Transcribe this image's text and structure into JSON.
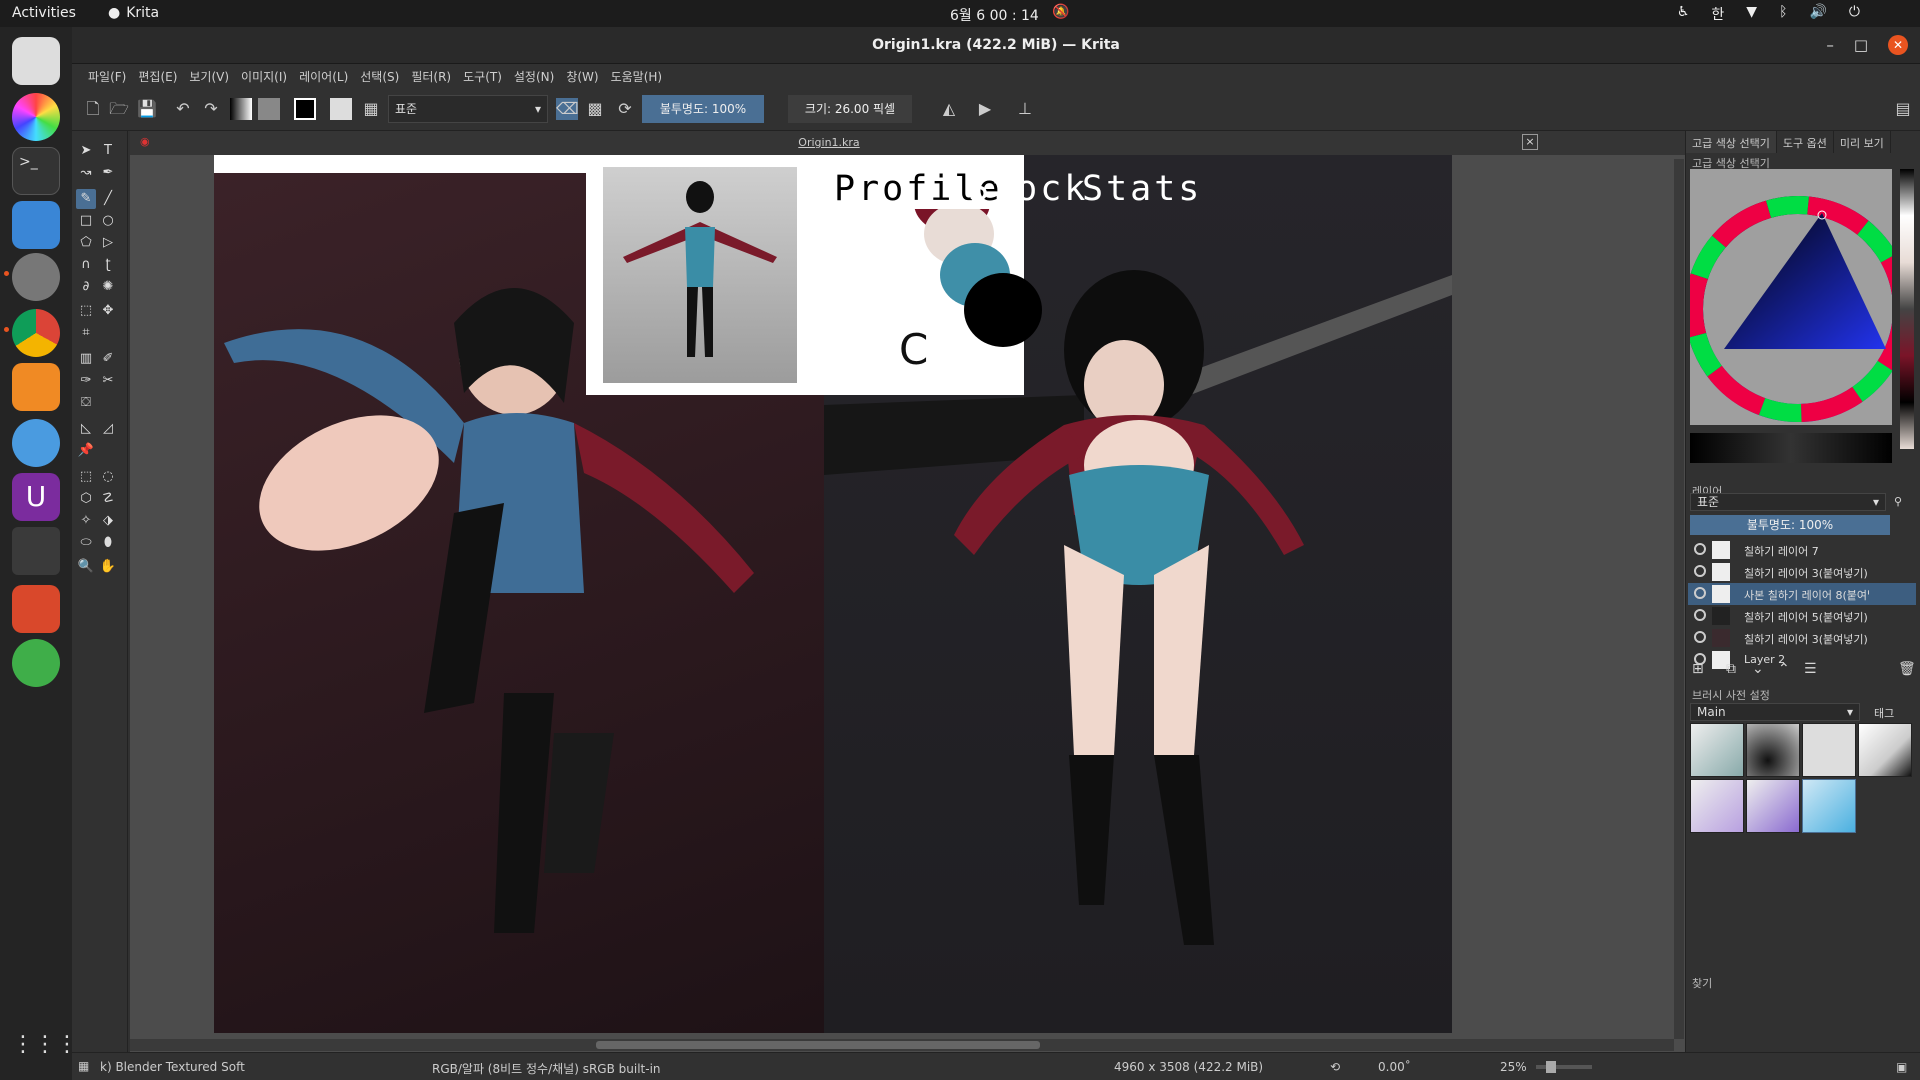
{
  "system": {
    "activities": "Activities",
    "app_name": "Krita",
    "clock": "6월 6  00 : 14",
    "tray_lang": "한"
  },
  "window": {
    "title": "Origin1.kra (422.2 MiB) — Krita",
    "minimize": "–",
    "maximize": "□",
    "close": "✕"
  },
  "menu": [
    "파일(F)",
    "편집(E)",
    "보기(V)",
    "이미지(I)",
    "레이어(L)",
    "선택(S)",
    "필터(R)",
    "도구(T)",
    "설정(N)",
    "창(W)",
    "도움말(H)"
  ],
  "toolbar": {
    "blend_mode": "표준",
    "opacity": "불투명도: 100%",
    "size": "크기: 26.00 픽셀"
  },
  "document": {
    "tab_name": "Origin1.kra",
    "tab_close": "×",
    "canvas_tabs": [
      "Profile",
      "Stock",
      "Stats"
    ],
    "palette_colors": [
      "#7a1428",
      "#e8dcd6",
      "#3f8fa8",
      "#000000"
    ]
  },
  "dockers": {
    "tabs": [
      "고급 색상 선택기",
      "도구 옵션",
      "미리 보기"
    ],
    "color_selector_title": "고급 색상 선택기",
    "layers_title": "레이어",
    "layers_blend": "표준",
    "layers_opacity": "불투명도: 100%",
    "layers": [
      {
        "name": "칠하기 레이어 7",
        "selected": false
      },
      {
        "name": "칠하기 레이어 3(붙여넣기)",
        "selected": false
      },
      {
        "name": "사본 칠하기 레이어 8(붙여넣...",
        "selected": true
      },
      {
        "name": "칠하기 레이어 5(붙여넣기)",
        "selected": false
      },
      {
        "name": "칠하기 레이어 3(붙여넣기)",
        "selected": false
      },
      {
        "name": "Layer 2",
        "selected": false
      }
    ],
    "brush_presets_title": "브러시 사전 설정",
    "brush_group": "Main",
    "brush_tag": "태그",
    "search_label": "찾기"
  },
  "status": {
    "brush": "k) Blender Textured Soft",
    "color_space": "RGB/알파 (8비트 정수/채널)  sRGB built-in",
    "dimensions": "4960 x 3508 (422.2 MiB)",
    "rotation": "0.00˚",
    "zoom": "25%"
  }
}
